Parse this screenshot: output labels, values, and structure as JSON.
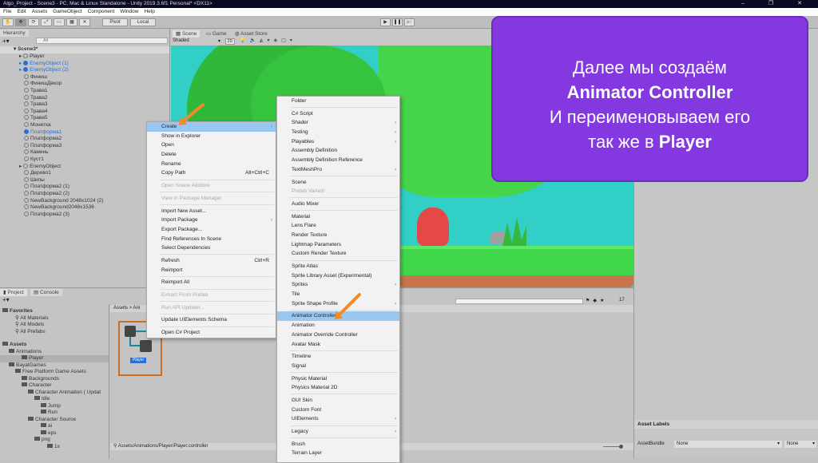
{
  "window": {
    "title": "Algo_Project - Scene3 - PC, Mac & Linux Standalone - Unity 2019.3.6f1 Personal* <DX11>",
    "controls": "– ❐ ✕"
  },
  "menubar": [
    "File",
    "Edit",
    "Assets",
    "GameObject",
    "Component",
    "Window",
    "Help"
  ],
  "toolbar": {
    "pivot": "Pivot",
    "local": "Local",
    "play": "▶",
    "pause": "❚❚",
    "step": "▶|"
  },
  "hierarchy": {
    "tab": "Hierarchy",
    "search_placeholder": "All",
    "scene": "Scene3*",
    "items": [
      {
        "label": "Player",
        "fold": true
      },
      {
        "label": "EnemyObject (1)",
        "fold": true,
        "sel": true
      },
      {
        "label": "EnemyObject (2)",
        "fold": true,
        "sel": true
      },
      {
        "label": "Финиш"
      },
      {
        "label": "ФинишДекор"
      },
      {
        "label": "Трава1"
      },
      {
        "label": "Трава2"
      },
      {
        "label": "Трава3"
      },
      {
        "label": "Трава4"
      },
      {
        "label": "Трава5"
      },
      {
        "label": "Монетка"
      },
      {
        "label": "Платформа1",
        "sel": true
      },
      {
        "label": "Платформа2"
      },
      {
        "label": "Платформа3"
      },
      {
        "label": "Камень"
      },
      {
        "label": "Куст1"
      },
      {
        "label": "EnemyObject",
        "fold": true
      },
      {
        "label": "Дерево1"
      },
      {
        "label": "Шипы"
      },
      {
        "label": "Платформа2 (1)"
      },
      {
        "label": "Платформа2 (2)"
      },
      {
        "label": "NewBackground 2048x1024 (2)"
      },
      {
        "label": "NewBackground2048x1536"
      },
      {
        "label": "Платформа2 (3)"
      }
    ]
  },
  "scene": {
    "tabs": [
      "Scene",
      "Game",
      "Asset Store"
    ],
    "shading": "Shaded",
    "mode2d": "2D"
  },
  "context_menu": [
    {
      "label": "Create",
      "arrow": true,
      "hl": true
    },
    {
      "label": "Show in Explorer"
    },
    {
      "label": "Open"
    },
    {
      "label": "Delete"
    },
    {
      "label": "Rename"
    },
    {
      "label": "Copy Path",
      "shortcut": "Alt+Ctrl+C"
    },
    {
      "sep": true
    },
    {
      "label": "Open Scene Additive",
      "dis": true
    },
    {
      "sep": true
    },
    {
      "label": "View in Package Manager",
      "dis": true
    },
    {
      "sep": true
    },
    {
      "label": "Import New Asset..."
    },
    {
      "label": "Import Package",
      "arrow": true
    },
    {
      "label": "Export Package..."
    },
    {
      "label": "Find References In Scene"
    },
    {
      "label": "Select Dependencies"
    },
    {
      "sep": true
    },
    {
      "label": "Refresh",
      "shortcut": "Ctrl+R"
    },
    {
      "label": "Reimport"
    },
    {
      "sep": true
    },
    {
      "label": "Reimport All"
    },
    {
      "sep": true
    },
    {
      "label": "Extract From Prefab",
      "dis": true
    },
    {
      "sep": true
    },
    {
      "label": "Run API Updater...",
      "dis": true
    },
    {
      "sep": true
    },
    {
      "label": "Update UIElements Schema"
    },
    {
      "sep": true
    },
    {
      "label": "Open C# Project"
    }
  ],
  "create_submenu": [
    {
      "label": "Folder"
    },
    {
      "sep": true
    },
    {
      "label": "C# Script"
    },
    {
      "label": "Shader",
      "arrow": true
    },
    {
      "label": "Testing",
      "arrow": true
    },
    {
      "label": "Playables",
      "arrow": true
    },
    {
      "label": "Assembly Definition"
    },
    {
      "label": "Assembly Definition Reference"
    },
    {
      "label": "TextMeshPro",
      "arrow": true
    },
    {
      "sep": true
    },
    {
      "label": "Scene"
    },
    {
      "label": "Prefab Variant",
      "dis": true
    },
    {
      "sep": true
    },
    {
      "label": "Audio Mixer"
    },
    {
      "sep": true
    },
    {
      "label": "Material"
    },
    {
      "label": "Lens Flare"
    },
    {
      "label": "Render Texture"
    },
    {
      "label": "Lightmap Parameters"
    },
    {
      "label": "Custom Render Texture"
    },
    {
      "sep": true
    },
    {
      "label": "Sprite Atlas"
    },
    {
      "label": "Sprite Library Asset (Experimental)"
    },
    {
      "label": "Sprites",
      "arrow": true
    },
    {
      "label": "Tile"
    },
    {
      "label": "Sprite Shape Profile",
      "arrow": true
    },
    {
      "sep": true
    },
    {
      "label": "Animator Controller",
      "hl": true
    },
    {
      "label": "Animation"
    },
    {
      "label": "Animator Override Controller"
    },
    {
      "label": "Avatar Mask"
    },
    {
      "sep": true
    },
    {
      "label": "Timeline"
    },
    {
      "label": "Signal"
    },
    {
      "sep": true
    },
    {
      "label": "Physic Material"
    },
    {
      "label": "Physics Material 2D"
    },
    {
      "sep": true
    },
    {
      "label": "GUI Skin"
    },
    {
      "label": "Custom Font"
    },
    {
      "label": "UIElements",
      "arrow": true
    },
    {
      "sep": true
    },
    {
      "label": "Legacy",
      "arrow": true
    },
    {
      "sep": true
    },
    {
      "label": "Brush"
    },
    {
      "label": "Terrain Layer"
    }
  ],
  "project": {
    "tabs": [
      "Project",
      "Console"
    ],
    "breadcrumb": "Assets > Ani",
    "tree": [
      {
        "label": "Favorites",
        "lvl": 0,
        "bold": true
      },
      {
        "label": "All Materials",
        "lvl": 2,
        "search": true
      },
      {
        "label": "All Models",
        "lvl": 2,
        "search": true
      },
      {
        "label": "All Prefabs",
        "lvl": 2,
        "search": true
      },
      {
        "label": "Assets",
        "lvl": 0,
        "bold": true,
        "gap": true
      },
      {
        "label": "Animations",
        "lvl": 1
      },
      {
        "label": "Player",
        "lvl": 3,
        "sel": true
      },
      {
        "label": "BayatGames",
        "lvl": 1
      },
      {
        "label": "Free Platform Game Assets",
        "lvl": 2
      },
      {
        "label": "Backgrounds",
        "lvl": 3
      },
      {
        "label": "Character",
        "lvl": 3
      },
      {
        "label": "Character Animation ( Updat",
        "lvl": 4
      },
      {
        "label": "Idle",
        "lvl": 5
      },
      {
        "label": "Jump",
        "lvl": 6
      },
      {
        "label": "Run",
        "lvl": 6
      },
      {
        "label": "Character Source",
        "lvl": 4
      },
      {
        "label": "ai",
        "lvl": 6
      },
      {
        "label": "eps",
        "lvl": 6
      },
      {
        "label": "png",
        "lvl": 5
      },
      {
        "label": "1x",
        "lvl": 7
      }
    ],
    "asset_label": "Player",
    "path": "Assets/Animations/Player/Player.controller",
    "count": "17"
  },
  "inspector": {
    "asset_labels": "Asset Labels",
    "assetbundle_label": "AssetBundle",
    "bundle_value": "None",
    "variant_value": "None"
  },
  "callout": {
    "line1": "Далее мы создаём",
    "line2": "Animator Controller",
    "line3": "И переименовываем его",
    "line4_prefix": "так же в ",
    "line4_bold": "Player"
  },
  "colors": {
    "callout": "#8338e0",
    "highlight": "#99c7f2",
    "arrow": "#f08a2a",
    "scene_bg": "#31cfc6"
  }
}
